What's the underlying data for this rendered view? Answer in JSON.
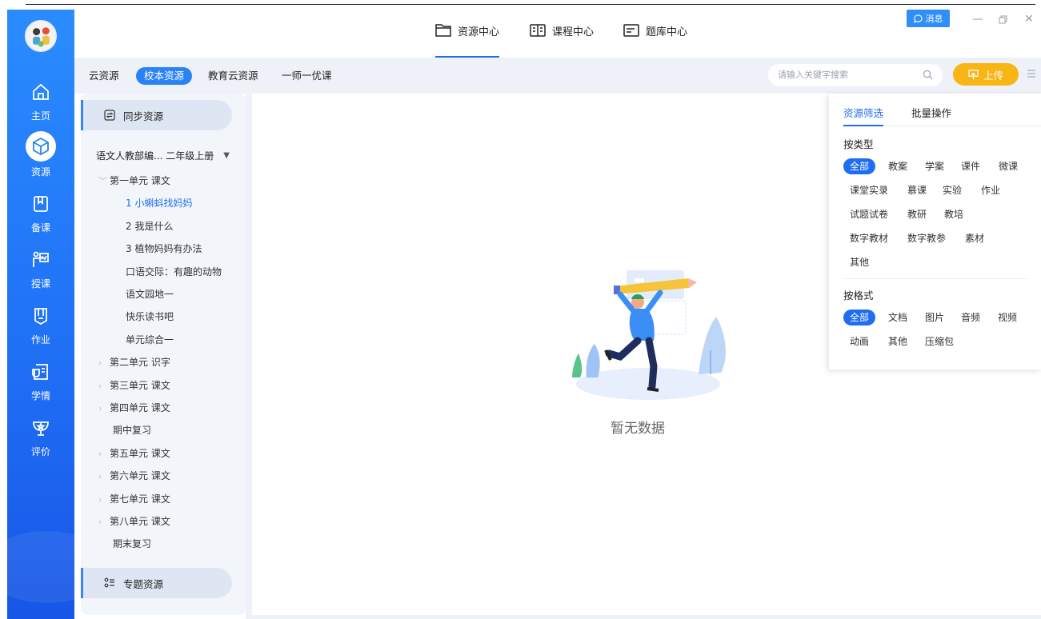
{
  "rail": {
    "items": [
      {
        "label": "主页",
        "icon": "home-icon"
      },
      {
        "label": "资源",
        "icon": "cube-icon",
        "active": true
      },
      {
        "label": "备课",
        "icon": "book-icon"
      },
      {
        "label": "授课",
        "icon": "teach-icon"
      },
      {
        "label": "作业",
        "icon": "homework-icon"
      },
      {
        "label": "学情",
        "icon": "report-icon"
      },
      {
        "label": "评价",
        "icon": "trophy-icon"
      }
    ]
  },
  "topnav": {
    "tabs": [
      {
        "label": "资源中心",
        "icon": "folder-icon",
        "active": true
      },
      {
        "label": "课程中心",
        "icon": "open-book-icon"
      },
      {
        "label": "题库中心",
        "icon": "list-card-icon"
      }
    ],
    "message_label": "消息"
  },
  "subbar": {
    "tabs": [
      {
        "label": "云资源"
      },
      {
        "label": "校本资源",
        "active": true
      },
      {
        "label": "教育云资源"
      },
      {
        "label": "一师一优课"
      }
    ],
    "search_placeholder": "请输入关键字搜索",
    "upload_label": "上传"
  },
  "sidebar": {
    "sync_label": "同步资源",
    "book_label": "语文人教部编... 二年级上册",
    "tree": [
      {
        "label": "第一单元 课文",
        "level": 0,
        "expanded": true
      },
      {
        "label": "1 小蝌蚪找妈妈",
        "level": 2,
        "current": true
      },
      {
        "label": "2 我是什么",
        "level": 2
      },
      {
        "label": "3 植物妈妈有办法",
        "level": 2
      },
      {
        "label": "口语交际：有趣的动物",
        "level": 2
      },
      {
        "label": "语文园地一",
        "level": 2
      },
      {
        "label": "快乐读书吧",
        "level": 2
      },
      {
        "label": "单元综合一",
        "level": 2
      },
      {
        "label": "第二单元 识字",
        "level": 0
      },
      {
        "label": "第三单元 课文",
        "level": 0
      },
      {
        "label": "第四单元 课文",
        "level": 0
      },
      {
        "label": "期中复习",
        "level": 1
      },
      {
        "label": "第五单元 课文",
        "level": 0
      },
      {
        "label": "第六单元 课文",
        "level": 0
      },
      {
        "label": "第七单元 课文",
        "level": 0
      },
      {
        "label": "第八单元 课文",
        "level": 0
      },
      {
        "label": "期末复习",
        "level": 1
      }
    ],
    "topic_label": "专题资源"
  },
  "main": {
    "empty_text": "暂无数据"
  },
  "filter": {
    "tabs": [
      {
        "label": "资源筛选",
        "active": true
      },
      {
        "label": "批量操作"
      }
    ],
    "type_section": "按类型",
    "type_chips": [
      "全部",
      "教案",
      "学案",
      "课件",
      "微课",
      "课堂实录",
      "慕课",
      "实验",
      "作业",
      "试题试卷",
      "教研",
      "教培",
      "数字教材",
      "数字教参",
      "素材",
      "其他"
    ],
    "format_section": "按格式",
    "format_chips": [
      "全部",
      "文档",
      "图片",
      "音频",
      "视频",
      "动画",
      "其他",
      "压缩包"
    ]
  },
  "colors": {
    "primary": "#1f6ef0",
    "rail": "#2a8cff",
    "upload": "#f7b615"
  }
}
